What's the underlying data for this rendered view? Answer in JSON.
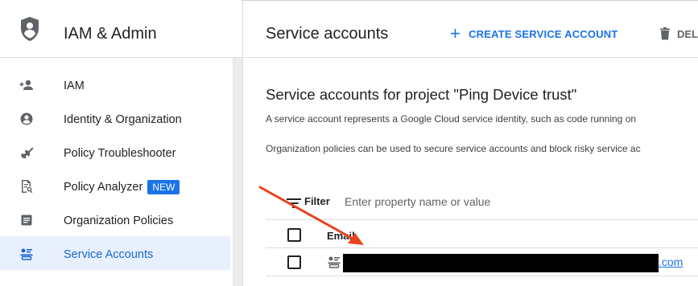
{
  "sidebar": {
    "title": "IAM & Admin",
    "items": [
      {
        "label": "IAM",
        "icon": "add-person-icon",
        "active": false
      },
      {
        "label": "Identity & Organization",
        "icon": "account-circle-icon",
        "active": false
      },
      {
        "label": "Policy Troubleshooter",
        "icon": "wrench-icon",
        "active": false
      },
      {
        "label": "Policy Analyzer",
        "icon": "document-search-icon",
        "active": false,
        "badge": "NEW"
      },
      {
        "label": "Organization Policies",
        "icon": "list-document-icon",
        "active": false
      },
      {
        "label": "Service Accounts",
        "icon": "service-account-icon",
        "active": true
      }
    ]
  },
  "header": {
    "title": "Service accounts",
    "create_label": "CREATE SERVICE ACCOUNT",
    "delete_label": "DEL"
  },
  "main": {
    "section_title": "Service accounts for project \"Ping Device trust\"",
    "description_1": "A service account represents a Google Cloud service identity, such as code running on",
    "description_2": "Organization policies can be used to secure service accounts and block risky service ac"
  },
  "filter": {
    "label": "Filter",
    "placeholder": "Enter property name or value"
  },
  "table": {
    "columns": [
      "Email"
    ],
    "rows": [
      {
        "email_visible_suffix": ".com",
        "redacted": true
      }
    ]
  },
  "colors": {
    "accent": "#1a73e8",
    "active_bg": "#e8f0fe",
    "annotation_arrow": "#e8431f",
    "redaction": "#000000"
  }
}
